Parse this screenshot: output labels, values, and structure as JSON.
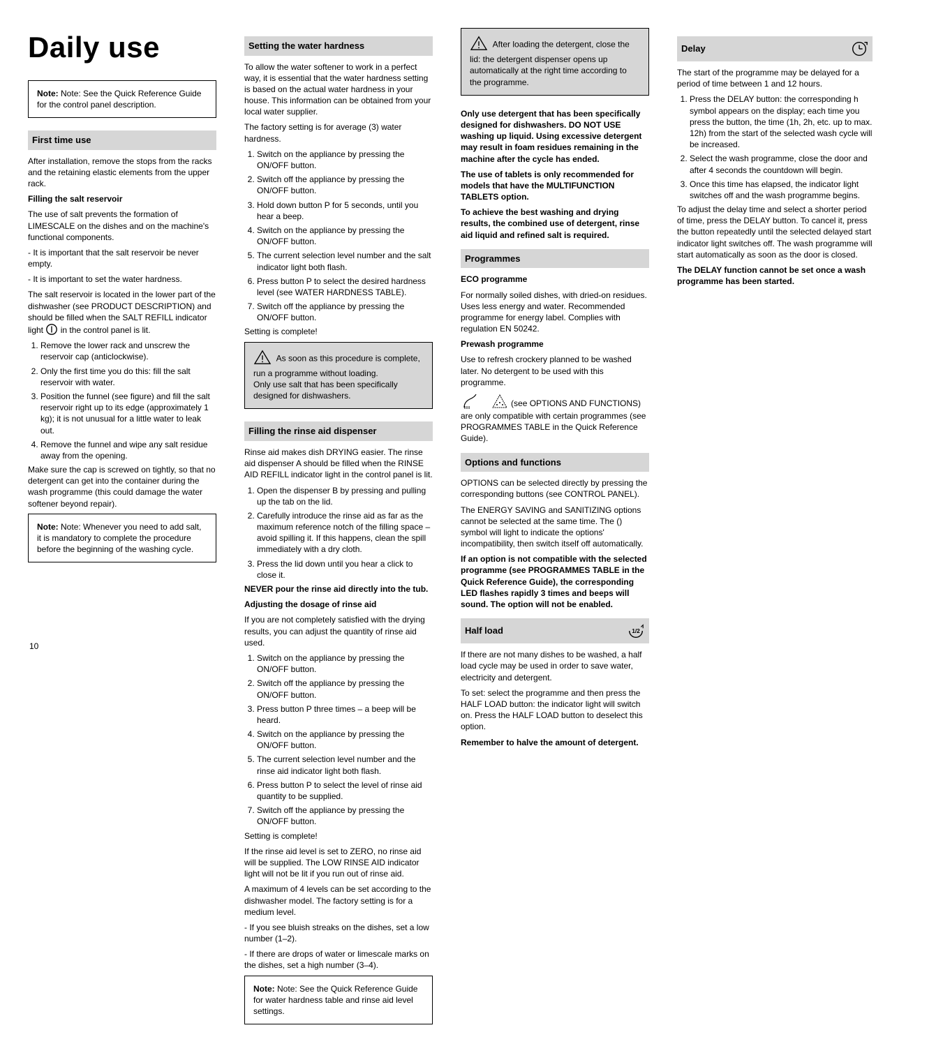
{
  "col1": {
    "title": "Daily use",
    "note1": "Note: See the Quick Reference Guide for the control panel description.",
    "sec1_title": "First time use",
    "sec1_p1": "After installation, remove the stops from the racks and the retaining elastic elements from the upper rack.",
    "sec1_sub1": "Filling the salt reservoir",
    "sec1_p2": "The use of salt prevents the formation of LIMESCALE on the dishes and on the machine's functional components.",
    "sec1_p3": "It is important that the salt reservoir be never empty.",
    "sec1_p4": "It is important to set the water hardness.",
    "sec1_p5": "The salt reservoir is located in the lower part of the dishwasher (see PRODUCT DESCRIPTION) and should be filled when the SALT REFILL indicator light ",
    "sec1_p5b": " in the control panel is lit.",
    "sec1_ol": [
      "Remove the lower rack and unscrew the reservoir cap (anticlockwise).",
      "Only the first time you do this: fill the salt reservoir with water.",
      "Position the funnel (see figure) and fill the salt reservoir right up to its edge (approximately 1 kg); it is not unusual for a little water to leak out.",
      "Remove the funnel and wipe any salt residue away from the opening."
    ],
    "sec1_p6": "Make sure the cap is screwed on tightly, so that no detergent can get into the container during the wash programme (this could damage the water softener beyond repair).",
    "note2": "Note: Whenever you need to add salt, it is mandatory to complete the procedure before the beginning of the washing cycle."
  },
  "col2": {
    "sec_sub1": "Setting the water hardness",
    "sec_p1": "To allow the water softener to work in a perfect way, it is essential that the water hardness setting is based on the actual water hardness in your house. This information can be obtained from your local water supplier.",
    "sec_p2": "The factory setting is for average (3) water hardness.",
    "sec_ol1": [
      "Switch on the appliance by pressing the ON/OFF button.",
      "Switch off the appliance by pressing the ON/OFF button.",
      "Hold down button P for 5 seconds, until you hear a beep.",
      "Switch on the appliance by pressing the ON/OFF button.",
      "The current selection level number and the salt indicator light both flash.",
      "Press button P to select the desired hardness level (see WATER HARDNESS TABLE).",
      "Switch off the appliance by pressing the ON/OFF button."
    ],
    "sec_p3": "Setting is complete!",
    "warn1": "As soon as this procedure is complete, run a programme without loading.",
    "warn2": "Only use salt that has been specifically designed for dishwashers.",
    "sec_sub2": "Filling the rinse aid dispenser",
    "sec_p4": "Rinse aid makes dish DRYING easier. The rinse aid dispenser A should be filled when the RINSE AID REFILL indicator light in the control panel is lit.",
    "sec_ol2": [
      "Open the dispenser B by pressing and pulling up the tab on the lid.",
      "Carefully introduce the rinse aid as far as the maximum reference notch of the filling space – avoid spilling it. If this happens, clean the spill immediately with a dry cloth.",
      "Press the lid down until you hear a click to close it."
    ],
    "sec_p5": "NEVER pour the rinse aid directly into the tub.",
    "sec_sub3": "Adjusting the dosage of rinse aid",
    "sec_p6": "If you are not completely satisfied with the drying results, you can adjust the quantity of rinse aid used.",
    "sec_ol3": [
      "Switch on the appliance by pressing the ON/OFF button.",
      "Switch off the appliance by pressing the ON/OFF button.",
      "Press button P three times – a beep will be heard.",
      "Switch on the appliance by pressing the ON/OFF button.",
      "The current selection level number and the rinse aid indicator light both flash.",
      "Press button P to select the level of rinse aid quantity to be supplied.",
      "Switch off the appliance by pressing the ON/OFF button."
    ],
    "sec_p7": "Setting is complete!",
    "sec_p8": "If the rinse aid level is set to ZERO, no rinse aid will be supplied. The LOW RINSE AID indicator light will not be lit if you run out of rinse aid.",
    "sec_p9": "A maximum of 4 levels can be set according to the dishwasher model. The factory setting is for a medium level.",
    "sec_li1": "If you see bluish streaks on the dishes, set a low number (1–2).",
    "sec_li2": "If there are drops of water or limescale marks on the dishes, set a high number (3–4).",
    "note3": "Note: See the Quick Reference Guide for water hardness table and rinse aid level settings."
  },
  "col3": {
    "warn_box": "After loading the detergent, close the lid: the detergent dispenser opens up automatically at the right time according to the programme.",
    "warn_p1": "Only use detergent that has been specifically designed for dishwashers. DO NOT USE washing up liquid. Using excessive detergent may result in foam residues remaining in the machine after the cycle has ended.",
    "warn_p2": "The use of tablets is only recommended for models that have the MULTIFUNCTION TABLETS option.",
    "warn_p3": "To achieve the best washing and drying results, the combined use of detergent, rinse aid liquid and refined salt is required.",
    "sec1_title": "Programmes",
    "sec1_sub1": "ECO programme",
    "sec1_p1": "For normally soiled dishes, with dried-on residues. Uses less energy and water. Recommended programme for energy label. Complies with regulation EN 50242.",
    "sec1_sub2": "Prewash programme",
    "sec1_p2": "Use to refresh crockery planned to be washed later. No detergent to be used with this programme.",
    "sec1_p3": "(see OPTIONS AND FUNCTIONS) are only compatible with certain programmes (see PROGRAMMES TABLE in the Quick Reference Guide).",
    "sec2_title": "Options and functions",
    "sec2_p1": "OPTIONS can be selected directly by pressing the corresponding buttons (see CONTROL PANEL).",
    "sec2_p2": "The ENERGY SAVING and SANITIZING options cannot be selected at the same time. The () symbol will light to indicate the options' incompatibility, then switch itself off automatically.",
    "sec2_p3": "If an option is not compatible with the selected programme (see PROGRAMMES TABLE in the Quick Reference Guide), the corresponding LED flashes rapidly 3 times and beeps will sound. The option will not be enabled.",
    "sec3_title": "Half load",
    "sec3_p1": "If there are not many dishes to be washed, a half load cycle may be used in order to save water, electricity and detergent.",
    "sec3_p2": "To set: select the programme and then press the HALF LOAD button: the indicator light will switch on. Press the HALF LOAD button to deselect this option.",
    "sec3_p3": "Remember to halve the amount of detergent."
  },
  "col4": {
    "sec1_title": "Delay",
    "sec1_p1": "The start of the programme may be delayed for a period of time between 1 and 12 hours.",
    "sec1_ol": [
      "Press the DELAY button: the corresponding h symbol appears on the display; each time you press the button, the time (1h, 2h, etc. up to max. 12h) from the start of the selected wash cycle will be increased.",
      "Select the wash programme, close the door and after 4 seconds the countdown will begin.",
      "Once this time has elapsed, the indicator light switches off and the wash programme begins."
    ],
    "sec1_p2": "To adjust the delay time and select a shorter period of time, press the DELAY button. To cancel it, press the button repeatedly until the selected delayed start indicator light switches off. The wash programme will start automatically as soon as the door is closed.",
    "sec1_p3": "The DELAY function cannot be set once a wash programme has been started."
  },
  "pagenum": "10"
}
